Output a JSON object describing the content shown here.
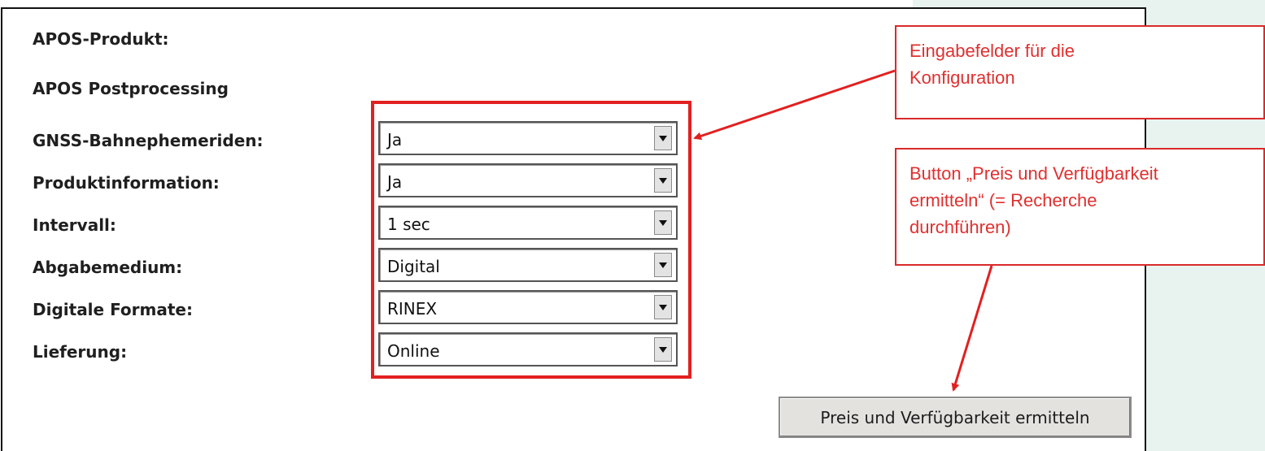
{
  "form": {
    "product_label": "APOS-Produkt:",
    "product_name": "APOS Postprocessing",
    "fields": [
      {
        "label": "GNSS-Bahnephemeriden:",
        "value": "Ja"
      },
      {
        "label": "Produktinformation:",
        "value": "Ja"
      },
      {
        "label": "Intervall:",
        "value": "1 sec"
      },
      {
        "label": "Abgabemedium:",
        "value": "Digital"
      },
      {
        "label": "Digitale Formate:",
        "value": "RINEX"
      },
      {
        "label": "Lieferung:",
        "value": "Online"
      }
    ],
    "submit_label": "Preis und Verfügbarkeit ermitteln"
  },
  "annotations": {
    "callout_1_line_1": "Eingabefelder für die",
    "callout_1_line_2": "Konfiguration",
    "callout_2_line_1": "Button „Preis und Verfügbarkeit",
    "callout_2_line_2": "ermitteln“ (= Recherche",
    "callout_2_line_3": "durchführen)"
  },
  "colors": {
    "annotation_red": "#e22020",
    "side_panel": "#e8f3f0",
    "button_bg": "#e4e2df"
  },
  "icons": {
    "dropdown": "chevron-down-icon"
  }
}
